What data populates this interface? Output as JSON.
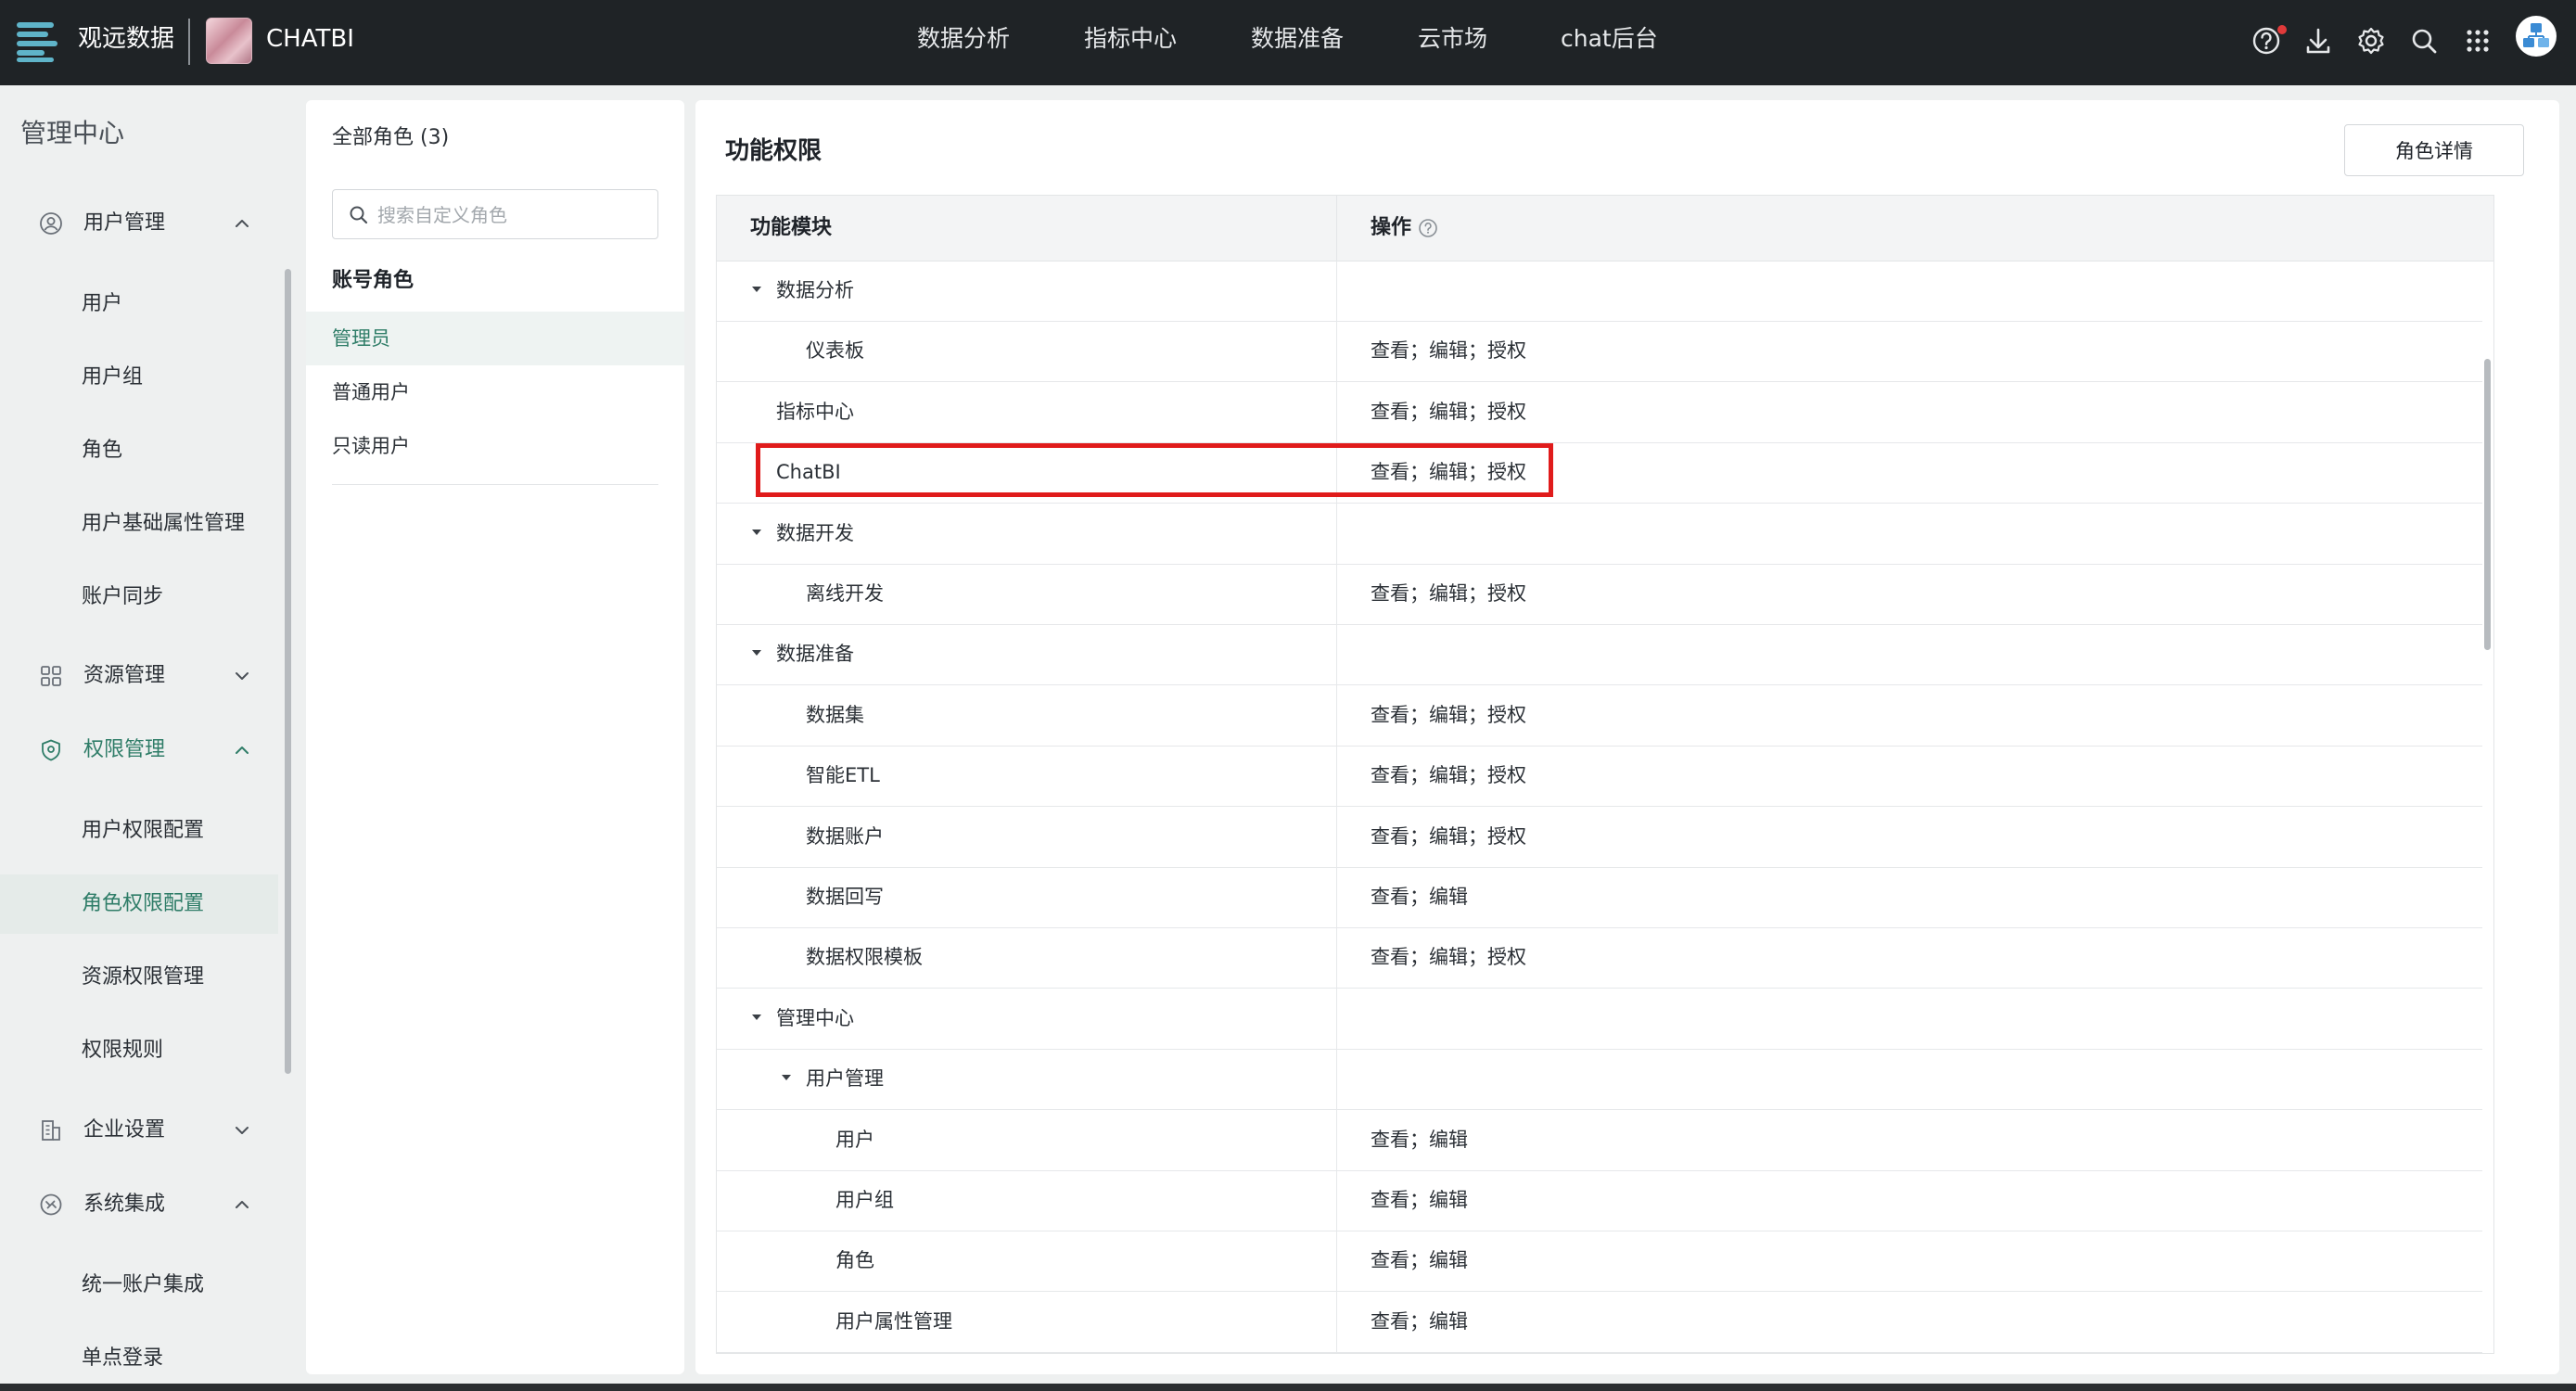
{
  "topbar": {
    "brand": "观远数据",
    "product": "CHATBI",
    "nav": [
      "数据分析",
      "指标中心",
      "数据准备",
      "云市场",
      "chat后台"
    ]
  },
  "sidebar": {
    "title": "管理中心",
    "groups": {
      "user_mgmt": {
        "label": "用户管理",
        "items": [
          "用户",
          "用户组",
          "角色",
          "用户基础属性管理",
          "账户同步"
        ]
      },
      "resource_mgmt": {
        "label": "资源管理"
      },
      "permission_mgmt": {
        "label": "权限管理",
        "items": [
          "用户权限配置",
          "角色权限配置",
          "资源权限管理",
          "权限规则"
        ]
      },
      "enterprise": {
        "label": "企业设置"
      },
      "integration": {
        "label": "系统集成",
        "items": [
          "统一账户集成",
          "单点登录"
        ]
      }
    }
  },
  "roles": {
    "header": "全部角色 (3)",
    "search_placeholder": "搜索自定义角色",
    "section": "账号角色",
    "items": [
      "管理员",
      "普通用户",
      "只读用户"
    ],
    "selected": "管理员"
  },
  "main": {
    "title": "功能权限",
    "detail_button": "角色详情",
    "col_module": "功能模块",
    "col_ops": "操作",
    "rows": [
      {
        "module": "数据分析",
        "ops": ""
      },
      {
        "module": "仪表板",
        "ops": "查看；编辑；授权"
      },
      {
        "module": "指标中心",
        "ops": "查看；编辑；授权"
      },
      {
        "module": "ChatBI",
        "ops": "查看；编辑；授权"
      },
      {
        "module": "数据开发",
        "ops": ""
      },
      {
        "module": "离线开发",
        "ops": "查看；编辑；授权"
      },
      {
        "module": "数据准备",
        "ops": ""
      },
      {
        "module": "数据集",
        "ops": "查看；编辑；授权"
      },
      {
        "module": "智能ETL",
        "ops": "查看；编辑；授权"
      },
      {
        "module": "数据账户",
        "ops": "查看；编辑；授权"
      },
      {
        "module": "数据回写",
        "ops": "查看；编辑"
      },
      {
        "module": "数据权限模板",
        "ops": "查看；编辑；授权"
      },
      {
        "module": "管理中心",
        "ops": ""
      },
      {
        "module": "用户管理",
        "ops": ""
      },
      {
        "module": "用户",
        "ops": "查看；编辑"
      },
      {
        "module": "用户组",
        "ops": "查看；编辑"
      },
      {
        "module": "角色",
        "ops": "查看；编辑"
      },
      {
        "module": "用户属性管理",
        "ops": "查看；编辑"
      }
    ]
  },
  "colors": {
    "topbar": "#1f2326",
    "accent": "#2f7d68",
    "highlight": "#e01b1b"
  }
}
